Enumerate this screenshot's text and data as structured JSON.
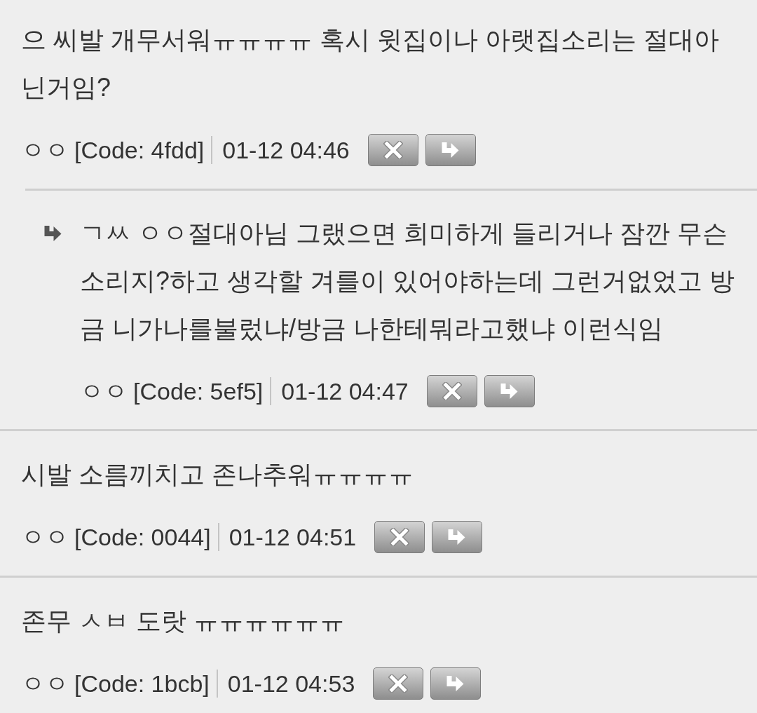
{
  "comments": [
    {
      "lines": [
        "으 씨발 개무서워ㅠㅠㅠㅠ 혹시 윗집이나 아랫집소리는 절대아",
        "닌거임?"
      ],
      "author": "ㅇㅇ",
      "code": "[Code: 4fdd]",
      "time": "01-12 04:46",
      "replies": [
        {
          "lines": [
            "ㄱㅆ ㅇㅇ절대아님 그랬으면 희미하게 들리거나 잠깐 무슨",
            "소리지?하고 생각할 겨를이 있어야하는데 그런거없었고 방",
            "금 니가나를불렀냐/방금 나한테뭐라고했냐 이런식임"
          ],
          "author": "ㅇㅇ",
          "code": "[Code: 5ef5]",
          "time": "01-12 04:47"
        }
      ]
    },
    {
      "lines": [
        "시발 소름끼치고 존나추워ㅠㅠㅠㅠ"
      ],
      "author": "ㅇㅇ",
      "code": "[Code: 0044]",
      "time": "01-12 04:51"
    },
    {
      "lines": [
        "존무 ㅅㅂ 도랏 ㅠㅠㅠㅠㅠㅠ"
      ],
      "author": "ㅇㅇ",
      "code": "[Code: 1bcb]",
      "time": "01-12 04:53"
    }
  ]
}
